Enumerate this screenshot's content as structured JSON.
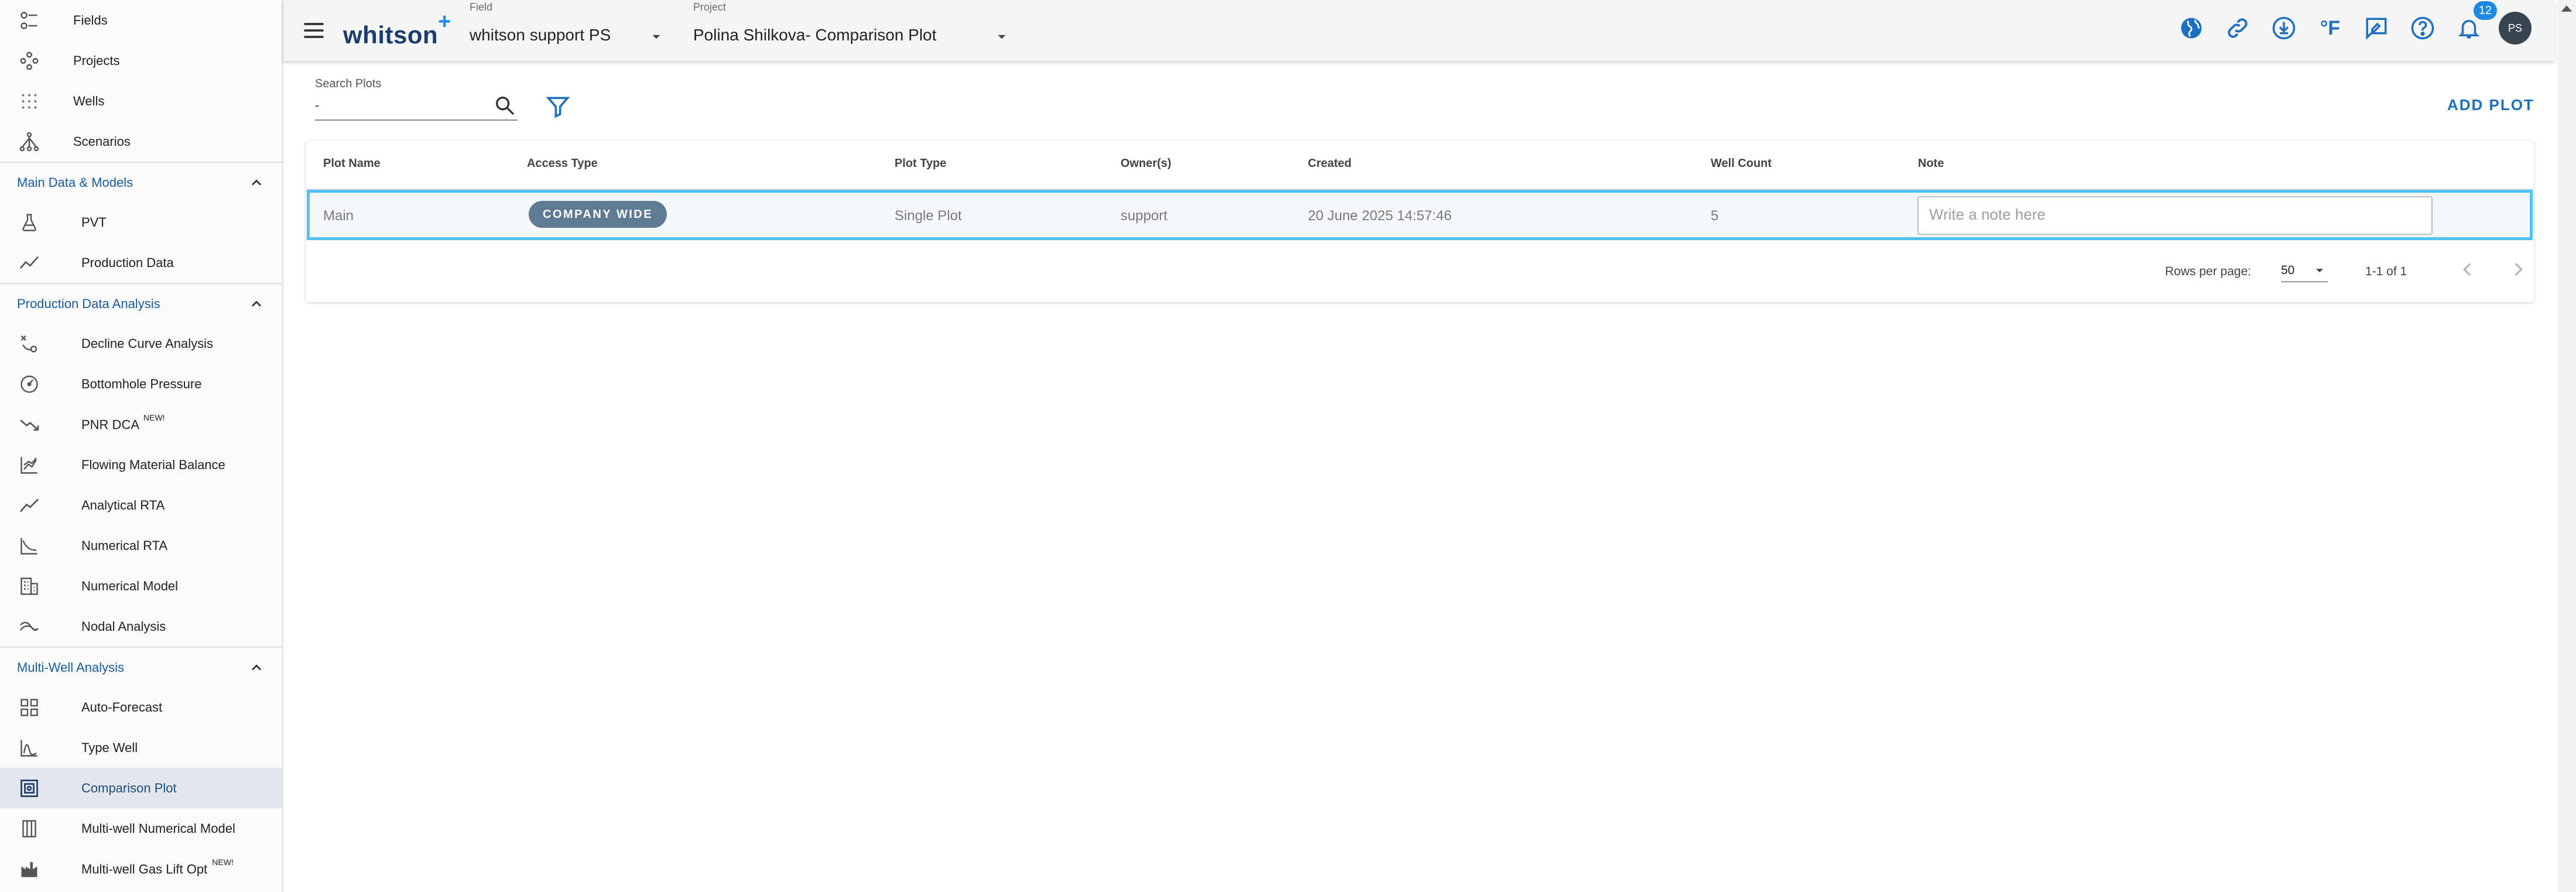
{
  "sidebar": {
    "top_items": [
      {
        "label": "Fields",
        "icon": "fields-icon"
      },
      {
        "label": "Projects",
        "icon": "projects-icon"
      },
      {
        "label": "Wells",
        "icon": "wells-icon"
      },
      {
        "label": "Scenarios",
        "icon": "scenarios-icon"
      }
    ],
    "sections": [
      {
        "title": "Main Data & Models",
        "items": [
          {
            "label": "PVT",
            "icon": "flask-icon"
          },
          {
            "label": "Production Data",
            "icon": "line-chart-icon"
          }
        ]
      },
      {
        "title": "Production Data Analysis",
        "items": [
          {
            "label": "Decline Curve Analysis",
            "icon": "decline-icon"
          },
          {
            "label": "Bottomhole Pressure",
            "icon": "gauge-icon"
          },
          {
            "label": "PNR DCA",
            "sup": "NEW!",
            "icon": "trend-down-icon"
          },
          {
            "label": "Flowing Material Balance",
            "icon": "area-chart-icon"
          },
          {
            "label": "Analytical RTA",
            "icon": "trend-line-icon"
          },
          {
            "label": "Numerical RTA",
            "icon": "curve-chart-icon"
          },
          {
            "label": "Numerical Model",
            "icon": "building-icon"
          },
          {
            "label": "Nodal Analysis",
            "icon": "nodal-icon"
          }
        ]
      },
      {
        "title": "Multi-Well Analysis",
        "items": [
          {
            "label": "Auto-Forecast",
            "icon": "grid-icon"
          },
          {
            "label": "Type Well",
            "icon": "type-well-icon"
          },
          {
            "label": "Comparison Plot",
            "icon": "comparison-icon",
            "active": true
          },
          {
            "label": "Multi-well Numerical Model",
            "icon": "columns-icon"
          },
          {
            "label": "Multi-well Gas Lift Opt",
            "sup": "NEW!",
            "icon": "factory-icon"
          }
        ]
      }
    ]
  },
  "header": {
    "logo": "whitson",
    "logo_plus": "+",
    "field_label": "Field",
    "field_value": "whitson support PS",
    "project_label": "Project",
    "project_value": "Polina Shilkova- Comparison Plot",
    "degree_unit": "°F",
    "notification_count": "12",
    "avatar_initials": "PS"
  },
  "toolbar": {
    "search_label": "Search Plots",
    "search_value": "-",
    "add_plot_label": "ADD PLOT"
  },
  "table": {
    "columns": [
      "Plot Name",
      "Access Type",
      "Plot Type",
      "Owner(s)",
      "Created",
      "Well Count",
      "Note"
    ],
    "rows": [
      {
        "plot_name": "Main",
        "access_type": "COMPANY WIDE",
        "plot_type": "Single Plot",
        "owners": "support",
        "created": "20 June 2025 14:57:46",
        "well_count": "5",
        "note_placeholder": "Write a note here"
      }
    ],
    "rows_per_page_label": "Rows per page:",
    "rows_per_page_value": "50",
    "range_text": "1-1 of 1"
  },
  "colors": {
    "accent": "#1a6fbf",
    "selected_row_border": "#4fc3f7",
    "pill_bg": "#5f7a93",
    "section_title": "#1a5c99"
  }
}
